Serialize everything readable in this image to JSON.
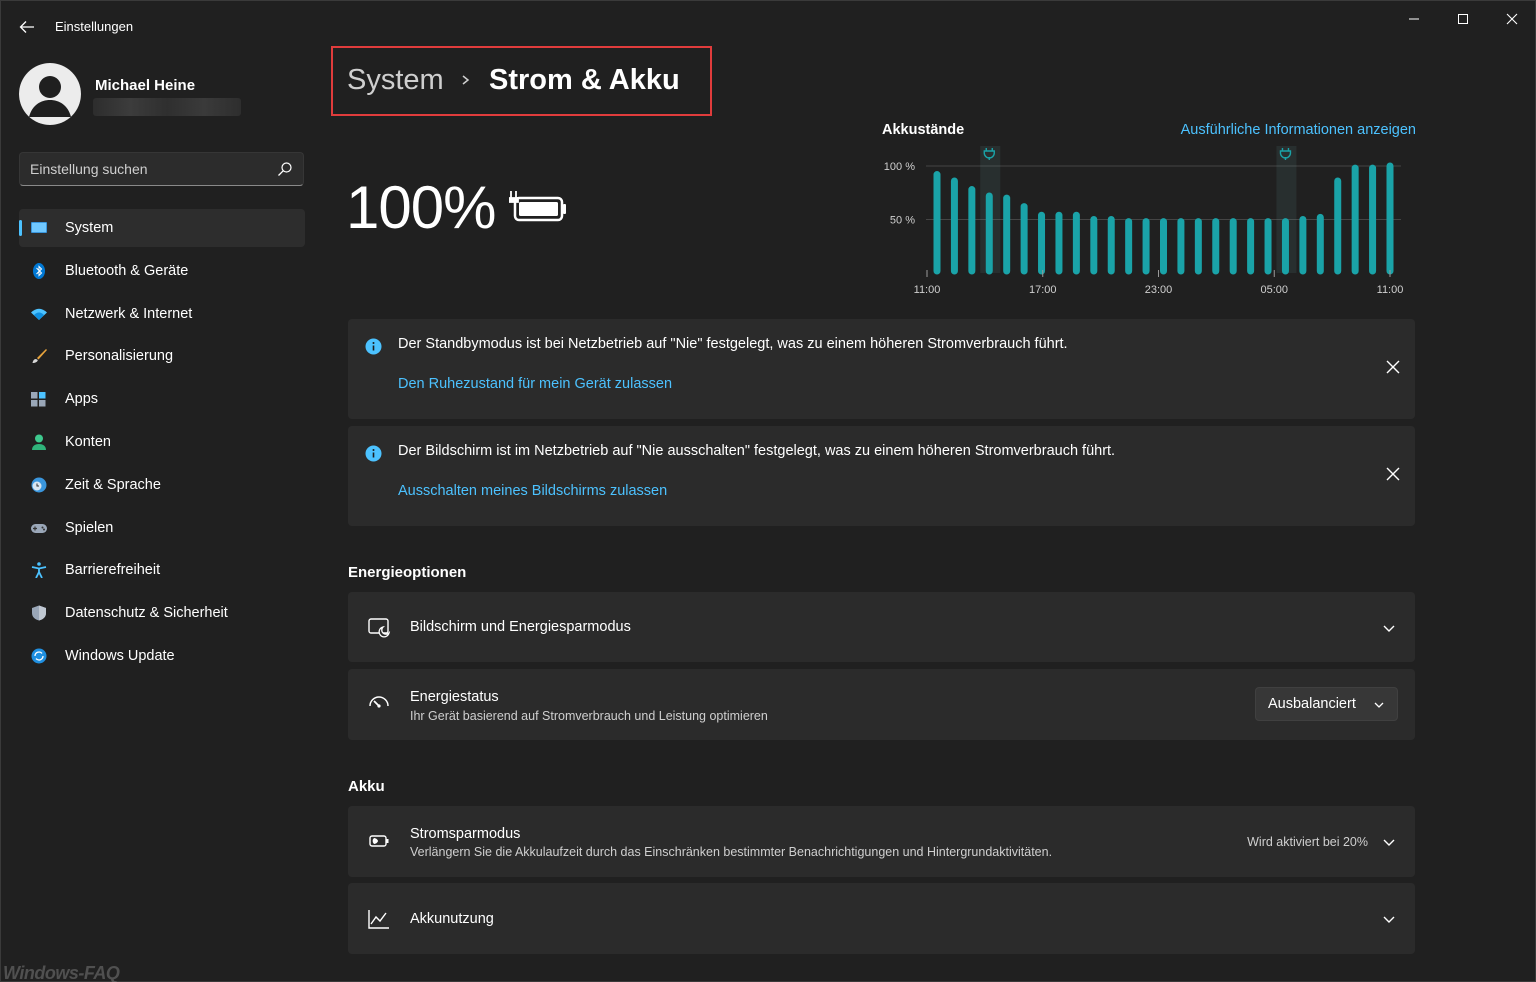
{
  "window": {
    "title": "Einstellungen",
    "controls": [
      "minimize",
      "maximize",
      "close"
    ]
  },
  "user": {
    "name": "Michael Heine"
  },
  "search": {
    "placeholder": "Einstellung suchen"
  },
  "sidebar": {
    "items": [
      {
        "label": "System",
        "icon": "system-icon",
        "active": true
      },
      {
        "label": "Bluetooth & Geräte",
        "icon": "bluetooth-icon"
      },
      {
        "label": "Netzwerk & Internet",
        "icon": "wifi-icon"
      },
      {
        "label": "Personalisierung",
        "icon": "brush-icon"
      },
      {
        "label": "Apps",
        "icon": "apps-icon"
      },
      {
        "label": "Konten",
        "icon": "account-icon"
      },
      {
        "label": "Zeit & Sprache",
        "icon": "globe-clock-icon"
      },
      {
        "label": "Spielen",
        "icon": "gamepad-icon"
      },
      {
        "label": "Barrierefreiheit",
        "icon": "accessibility-icon"
      },
      {
        "label": "Datenschutz & Sicherheit",
        "icon": "shield-icon"
      },
      {
        "label": "Windows Update",
        "icon": "update-icon"
      }
    ]
  },
  "header": {
    "parent": "System",
    "current": "Strom & Akku"
  },
  "battery": {
    "percent": "100%",
    "icon": "battery-charging-icon"
  },
  "chart": {
    "title": "Akkustände",
    "link": "Ausführliche Informationen anzeigen"
  },
  "chart_data": {
    "type": "bar",
    "title": "Akkustände",
    "x_ticks": [
      "11:00",
      "17:00",
      "23:00",
      "05:00",
      "11:00"
    ],
    "y_ticks": [
      "100 %",
      "50 %"
    ],
    "ylim": [
      0,
      100
    ],
    "values": [
      92,
      86,
      78,
      72,
      70,
      62,
      54,
      54,
      54,
      50,
      50,
      48,
      48,
      48,
      48,
      48,
      48,
      48,
      48,
      48,
      48,
      50,
      52,
      86,
      98,
      98,
      100
    ],
    "plug_markers": [
      3,
      20
    ],
    "grid": true,
    "color": "#1aa3a8"
  },
  "notices": [
    {
      "message": "Der Standbymodus ist bei Netzbetrieb auf \"Nie\" festgelegt, was zu einem höheren Stromverbrauch führt.",
      "link": "Den Ruhezustand für mein Gerät zulassen"
    },
    {
      "message": "Der Bildschirm ist im Netzbetrieb auf \"Nie ausschalten\" festgelegt, was zu einem höheren Stromverbrauch führt.",
      "link": "Ausschalten meines Bildschirms zulassen"
    }
  ],
  "energy": {
    "heading": "Energieoptionen",
    "screen_sleep": {
      "title": "Bildschirm und Energiesparmodus"
    },
    "power_mode": {
      "title": "Energiestatus",
      "subtitle": "Ihr Gerät basierend auf Stromverbrauch und Leistung optimieren",
      "value": "Ausbalanciert"
    }
  },
  "akku": {
    "heading": "Akku",
    "saver": {
      "title": "Stromsparmodus",
      "subtitle": "Verlängern Sie die Akkulaufzeit durch das Einschränken bestimmter Benachrichtigungen und Hintergrundaktivitäten.",
      "value": "Wird aktiviert bei 20%"
    },
    "usage": {
      "title": "Akkunutzung"
    }
  },
  "watermark": "Windows-FAQ",
  "colors": {
    "accent": "#4cc2ff",
    "bar": "#1aa3a8",
    "highlight_box": "#e03c3c"
  }
}
